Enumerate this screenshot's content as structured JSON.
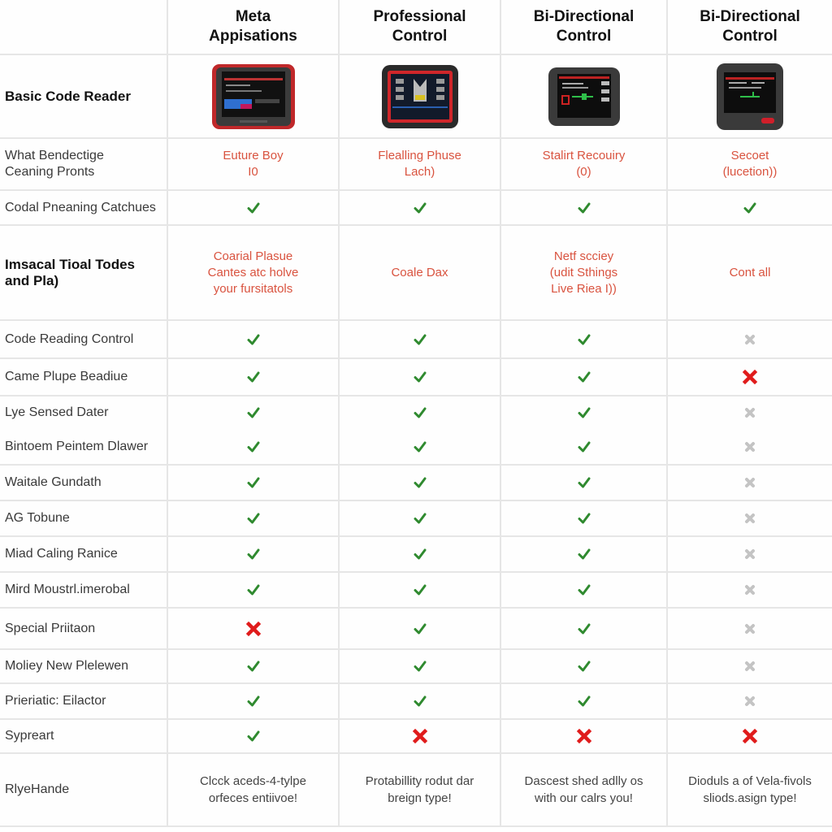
{
  "columns": [
    {
      "title": "Meta\nAppisations",
      "line1": "Meta",
      "line2": "Appisations"
    },
    {
      "title": "Professional Control",
      "line1": "Professional",
      "line2": "Control"
    },
    {
      "title": "Bi-Directional Control",
      "line1": "Bi-Directional",
      "line2": "Control"
    },
    {
      "title": "Bi-Directional Control",
      "line1": "Bi-Directional",
      "line2": "Control"
    }
  ],
  "device_row": {
    "label": "Basic Code Reader",
    "devices": [
      {
        "icon": "scan-tool-red-frame-icon",
        "frame_color": "#c0282a",
        "screen_accent": "#2f6fd0"
      },
      {
        "icon": "scan-tool-rugged-icon",
        "frame_color": "#2a2a2a",
        "screen_accent": "#d0262a"
      },
      {
        "icon": "scan-tool-dark-icon",
        "frame_color": "#3a3a3a",
        "screen_accent": "#2fbf4a"
      },
      {
        "icon": "scan-tool-handheld-icon",
        "frame_color": "#3a3a3a",
        "screen_accent": "#2fbf4a"
      }
    ]
  },
  "rows": [
    {
      "label": "What Bendectige\nCeaning Pronts",
      "type": "text",
      "values": [
        [
          "Euture Boy",
          "I0"
        ],
        [
          "Flealling Phuse",
          "Lach)"
        ],
        [
          "Stalirt Recouiry",
          "(0)"
        ],
        [
          "Secoet",
          "(lucetion))"
        ]
      ]
    },
    {
      "label": "Codal Pneaning Catchues",
      "type": "marks",
      "values": [
        "check",
        "check",
        "check",
        "check"
      ]
    },
    {
      "label": "Imsacal Tioal Todes\nand Pla)",
      "bold": true,
      "type": "text",
      "values": [
        [
          "Coarial Plasue",
          "Cantes atc holve",
          "your fursitatols"
        ],
        [
          "Coale Dax"
        ],
        [
          "Netf scciey",
          "(udit Sthings",
          "Live Riea I))"
        ],
        [
          "Cont all"
        ]
      ]
    },
    {
      "label": "Code Reading Control",
      "type": "marks",
      "values": [
        "check",
        "check",
        "check",
        "cross-grey"
      ]
    },
    {
      "label": "Came Plupe Beadiue",
      "type": "marks",
      "values": [
        "check",
        "check",
        "check",
        "cross-red"
      ]
    },
    {
      "label": "Lye Sensed Dater",
      "type": "marks",
      "values": [
        "check",
        "check",
        "check",
        "cross-grey"
      ]
    },
    {
      "label": "Bintoem Peintem Dlawer",
      "type": "marks",
      "values": [
        "check",
        "check",
        "check",
        "cross-grey"
      ]
    },
    {
      "label": "Waitale Gundath",
      "type": "marks",
      "values": [
        "check",
        "check",
        "check",
        "cross-grey"
      ]
    },
    {
      "label": "AG Tobune",
      "type": "marks",
      "values": [
        "check",
        "check",
        "check",
        "cross-grey"
      ]
    },
    {
      "label": "Miad Caling Ranice",
      "type": "marks",
      "values": [
        "check",
        "check",
        "check",
        "cross-grey"
      ]
    },
    {
      "label": "Mird Moustrl.imerobal",
      "type": "marks",
      "values": [
        "check",
        "check",
        "check",
        "cross-grey"
      ]
    },
    {
      "label": "Special Priitaon",
      "type": "marks",
      "values": [
        "cross-red",
        "check",
        "check",
        "cross-grey"
      ]
    },
    {
      "label": "Moliey New Plelewen",
      "type": "marks",
      "values": [
        "check",
        "check",
        "check",
        "cross-grey"
      ]
    },
    {
      "label": "Prieriatic: Eilactor",
      "type": "marks",
      "values": [
        "check",
        "check",
        "check",
        "cross-grey"
      ]
    },
    {
      "label": "Sypreart",
      "type": "marks",
      "values": [
        "check",
        "cross-red",
        "cross-red",
        "cross-red"
      ]
    },
    {
      "label": "RlyeHande",
      "type": "desc",
      "values": [
        [
          "Clcck aceds-4-tylpe",
          "orfeces entiivoe!"
        ],
        [
          "Protabillity rodut dar",
          "breign type!"
        ],
        [
          "Dascest shed adlly os",
          "with our calrs you!"
        ],
        [
          "Dioduls a of Vela-fivols",
          "sliods.asign type!"
        ]
      ]
    }
  ],
  "colors": {
    "check": "#2f8a2f",
    "cross_red": "#e01b1b",
    "cross_grey": "#c4c4c4",
    "accent_text": "#d9533f",
    "grid_line": "#e6e6e6"
  }
}
